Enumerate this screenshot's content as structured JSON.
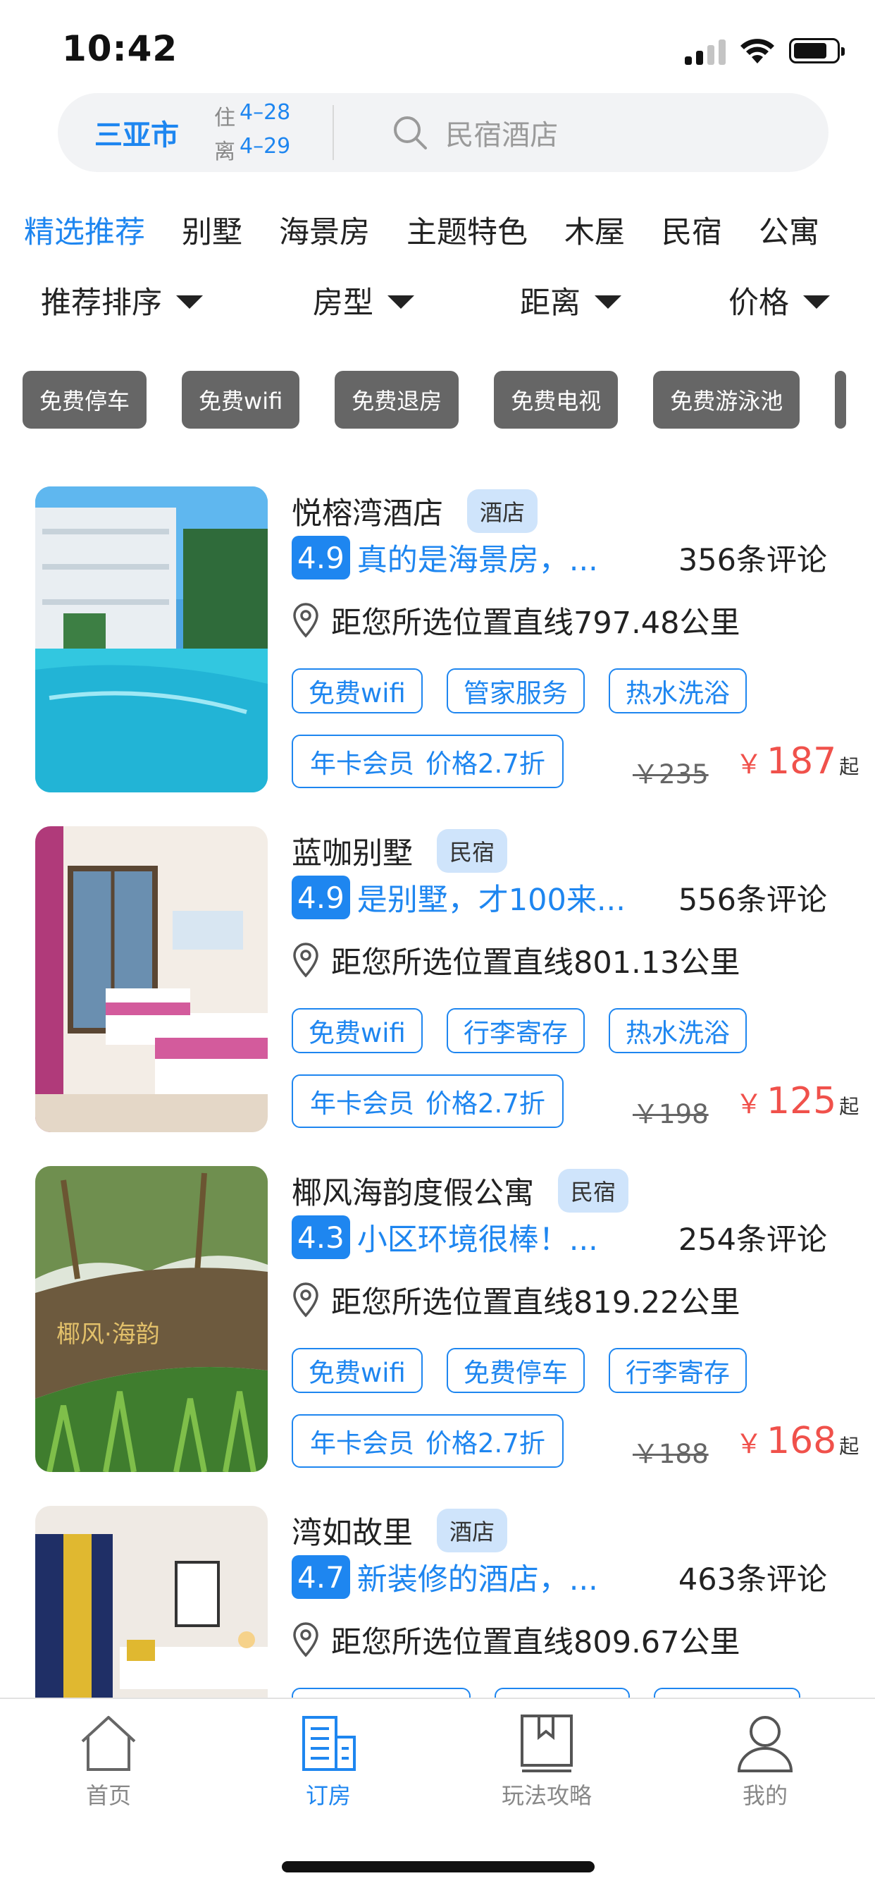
{
  "status_bar": {
    "time": "10:42",
    "icons": [
      "signal-icon",
      "wifi-icon",
      "battery-icon"
    ]
  },
  "search": {
    "city": "三亚市",
    "checkin_label": "住",
    "checkin_date": "4–28",
    "checkout_label": "离",
    "checkout_date": "4–29",
    "placeholder": "民宿酒店"
  },
  "tabs": [
    {
      "label": "精选推荐",
      "active": true
    },
    {
      "label": "别墅",
      "active": false
    },
    {
      "label": "海景房",
      "active": false
    },
    {
      "label": "主题特色",
      "active": false
    },
    {
      "label": "木屋",
      "active": false
    },
    {
      "label": "民宿",
      "active": false
    },
    {
      "label": "公寓",
      "active": false
    }
  ],
  "filters": [
    {
      "label": "推荐排序"
    },
    {
      "label": "房型"
    },
    {
      "label": "距离"
    },
    {
      "label": "价格"
    }
  ],
  "chips": [
    "免费停车",
    "免费wifi",
    "免费退房",
    "免费电视",
    "免费游泳池",
    ""
  ],
  "listings": [
    {
      "name": "悦榕湾酒店",
      "type": "酒店",
      "rating": "4.9",
      "snippet": "真的是海景房，...",
      "reviews": "356条评论",
      "distance": "距您所选位置直线797.48公里",
      "features": [
        "免费wifi",
        "管家服务",
        "热水洗浴"
      ],
      "member_label": "年卡会员",
      "member_price": "价格2.7折",
      "original_price": "￥235",
      "currency": "￥",
      "price": "187",
      "price_suffix": "起",
      "image": "pool-hotel-photo"
    },
    {
      "name": "蓝咖别墅",
      "type": "民宿",
      "rating": "4.9",
      "snippet": "是别墅，才100来...",
      "reviews": "556条评论",
      "distance": "距您所选位置直线801.13公里",
      "features": [
        "免费wifi",
        "行李寄存",
        "热水洗浴"
      ],
      "member_label": "年卡会员",
      "member_price": "价格2.7折",
      "original_price": "￥198",
      "currency": "￥",
      "price": "125",
      "price_suffix": "起",
      "image": "twin-bedroom-photo"
    },
    {
      "name": "椰风海韵度假公寓",
      "type": "民宿",
      "rating": "4.3",
      "snippet": "小区环境很棒！...",
      "reviews": "254条评论",
      "distance": "距您所选位置直线819.22公里",
      "features": [
        "免费wifi",
        "免费停车",
        "行李寄存"
      ],
      "member_label": "年卡会员",
      "member_price": "价格2.7折",
      "original_price": "￥188",
      "currency": "￥",
      "price": "168",
      "price_suffix": "起",
      "image": "palm-sign-photo",
      "image_text": "椰风·海韵"
    },
    {
      "name": "湾如故里",
      "type": "酒店",
      "rating": "4.7",
      "snippet": "新装修的酒店，...",
      "reviews": "463条评论",
      "distance": "距您所选位置直线809.67公里",
      "features": [
        "",
        "",
        ""
      ],
      "member_label": "",
      "member_price": "",
      "original_price": "",
      "currency": "",
      "price": "",
      "price_suffix": "",
      "image": "bedroom-curtain-photo"
    }
  ],
  "bottom_nav": [
    {
      "label": "首页",
      "icon": "home-icon",
      "active": false
    },
    {
      "label": "订房",
      "icon": "building-icon",
      "active": true
    },
    {
      "label": "玩法攻略",
      "icon": "book-icon",
      "active": false
    },
    {
      "label": "我的",
      "icon": "user-icon",
      "active": false
    }
  ],
  "colors": {
    "accent": "#1e86f0",
    "price": "#f0514b",
    "chip_bg": "#666666",
    "badge_bg": "#cfe4fb",
    "search_bg": "#f2f3f5"
  }
}
